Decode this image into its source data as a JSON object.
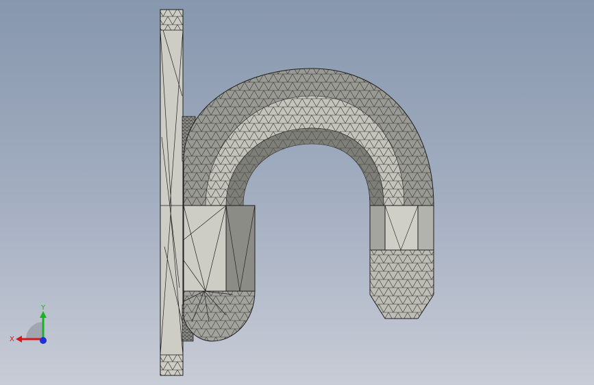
{
  "viewport": {
    "background_top": "#8797ad",
    "background_bottom": "#c8ccd6"
  },
  "model": {
    "face_light": "#ccccc4",
    "face_mid": "#a9a9a2",
    "face_dark": "#858580",
    "edge_color": "#1d1d1d"
  },
  "triad": {
    "x_label": "X",
    "y_label": "Y",
    "x_color": "#d9151c",
    "y_color": "#19b225",
    "z_color": "#1f2fd6"
  }
}
